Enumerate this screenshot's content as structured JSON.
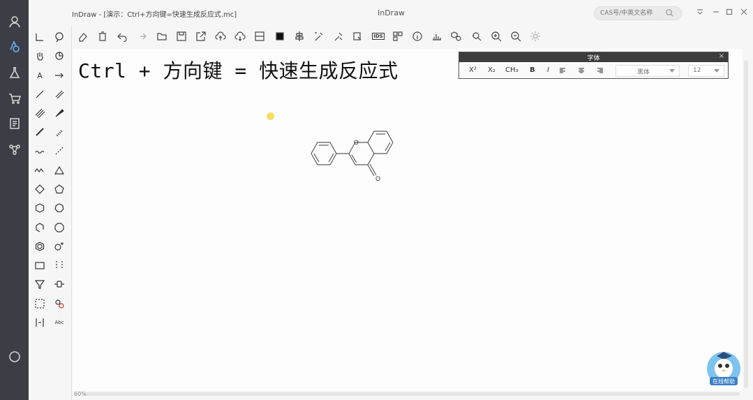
{
  "window": {
    "file_title": "InDraw - [演示：Ctrl+方向键=快速生成反应式.mc]",
    "app_title": "InDraw",
    "search_placeholder": "CAS号/中英文名称"
  },
  "canvas": {
    "heading": "Ctrl + 方向键 = 快速生成反应式",
    "atom_labels": [
      "O",
      "O"
    ],
    "zoom": "60%"
  },
  "font_panel": {
    "title": "字体",
    "superscript": "X²",
    "subscript": "X₂",
    "chem_format": "CH₃",
    "bold": "B",
    "italic": "I",
    "font_name": "黑体",
    "font_size": "12"
  },
  "tools": {
    "text_tool": "A",
    "abc_tool": "Abc"
  },
  "toolbar": {
    "ids_label": "IDS"
  },
  "help": {
    "label": "在线帮助"
  },
  "colors": {
    "nav_bg": "#3b3e44",
    "panel_head": "#3d3d3d",
    "accent": "#6fb6ff"
  }
}
